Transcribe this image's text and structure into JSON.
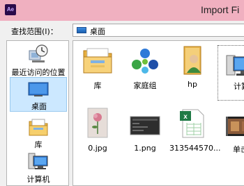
{
  "window": {
    "title": "Import Fi",
    "app_icon_text": "Ae"
  },
  "location_bar": {
    "label": "查找范围(I)：",
    "value": "桌面"
  },
  "sidebar": {
    "items": [
      {
        "label": "最近访问的位置",
        "icon": "recent-places-icon"
      },
      {
        "label": "桌面",
        "icon": "desktop-icon",
        "selected": true
      },
      {
        "label": "库",
        "icon": "libraries-icon"
      },
      {
        "label": "计算机",
        "icon": "computer-icon"
      }
    ]
  },
  "files": [
    {
      "label": "库",
      "icon": "library-folder-icon"
    },
    {
      "label": "家庭组",
      "icon": "homegroup-icon"
    },
    {
      "label": "hp",
      "icon": "user-folder-icon"
    },
    {
      "label": "计算",
      "icon": "computer-icon"
    },
    {
      "label": "0.jpg",
      "icon": "image-thumbnail-icon"
    },
    {
      "label": "1.png",
      "icon": "image-thumbnail-icon"
    },
    {
      "label": "313544570...",
      "icon": "excel-file-icon"
    },
    {
      "label": "单击",
      "icon": "video-file-icon"
    }
  ],
  "colors": {
    "title_bar": "#f0b0c0",
    "selection": "#cce8ff",
    "window_bg": "#f0f0f0"
  }
}
